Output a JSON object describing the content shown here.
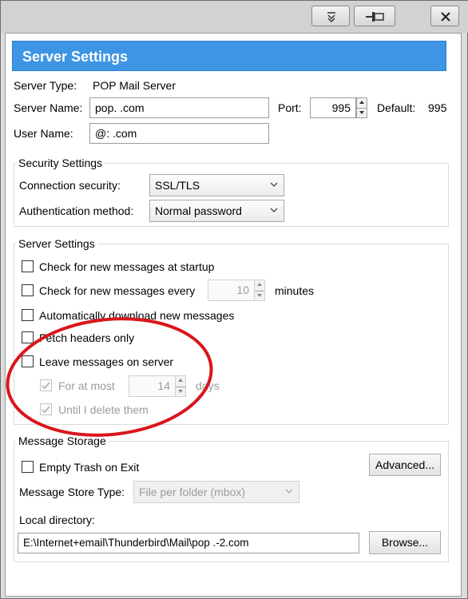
{
  "window": {
    "controls": [
      {
        "name": "collapse-button",
        "glyph": "⇊"
      },
      {
        "name": "pin-button",
        "glyph": "⊸"
      },
      {
        "name": "close-button",
        "glyph": "✕"
      }
    ]
  },
  "header": {
    "title": "Server Settings"
  },
  "server": {
    "type_label": "Server Type:",
    "type_value": "POP Mail Server",
    "name_label": "Server Name:",
    "name_value": "pop.        .com",
    "port_label": "Port:",
    "port_value": "995",
    "default_label": "Default:",
    "default_value": "995",
    "user_label": "User Name:",
    "user_value": "       @:        .com"
  },
  "security": {
    "title": "Security Settings",
    "connection_label": "Connection security:",
    "connection_value": "SSL/TLS",
    "auth_label": "Authentication method:",
    "auth_value": "Normal password"
  },
  "server_settings": {
    "title": "Server Settings",
    "check_startup": {
      "label": "Check for new messages at startup",
      "checked": false
    },
    "check_every": {
      "label": "Check for new messages every",
      "checked": false,
      "value": "10",
      "unit": "minutes"
    },
    "auto_download": {
      "label": "Automatically download new messages",
      "checked": false
    },
    "headers_only": {
      "label": "Fetch headers only",
      "checked": false
    },
    "leave_on_server": {
      "label": "Leave messages on server",
      "checked": false
    },
    "for_at_most": {
      "label": "For at most",
      "checked": true,
      "value": "14",
      "unit": "days"
    },
    "until_delete": {
      "label": "Until I delete them",
      "checked": true
    }
  },
  "storage": {
    "title": "Message Storage",
    "empty_trash": {
      "label": "Empty Trash on Exit",
      "checked": false
    },
    "advanced_button": "Advanced...",
    "store_type_label": "Message Store Type:",
    "store_type_value": "File per folder (mbox)",
    "local_dir_label": "Local directory:",
    "local_dir_value": "E:\\Internet+email\\Thunderbird\\Mail\\pop        .-2.com",
    "browse_button": "Browse..."
  },
  "colors": {
    "header_bg": "#3d95e4",
    "annotation_circle": "#d9161c"
  }
}
